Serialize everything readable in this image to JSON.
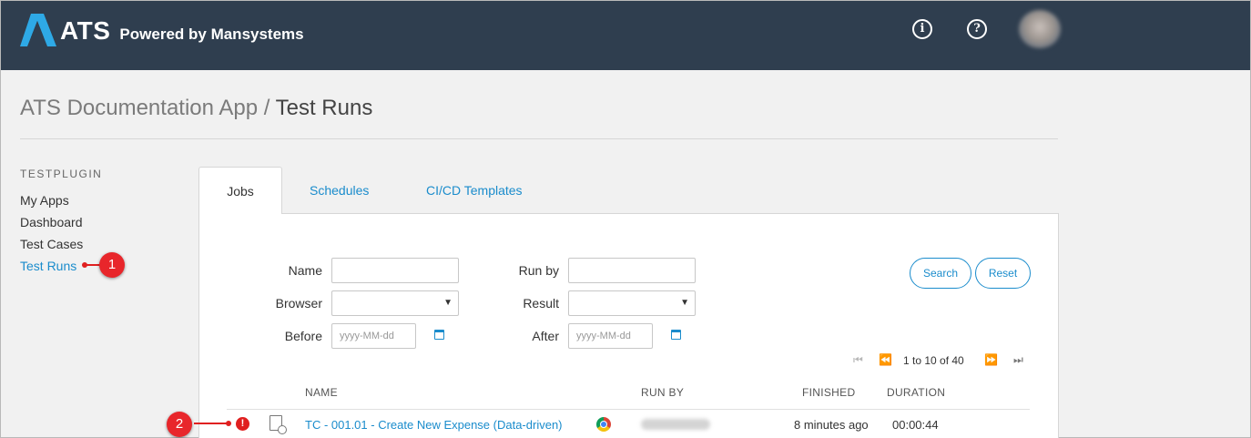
{
  "header": {
    "logo_text": "ATS",
    "logo_sub": "Powered by Mansystems",
    "info_icon": "info-icon",
    "help_icon": "help-icon",
    "colors": {
      "bar": "#2f3e4f",
      "accent": "#1a8ccc",
      "marker": "#e02020"
    }
  },
  "breadcrumb": {
    "app": "ATS Documentation App",
    "separator": " / ",
    "current": "Test Runs"
  },
  "sidebar": {
    "title": "TESTPLUGIN",
    "items": [
      {
        "label": "My Apps"
      },
      {
        "label": "Dashboard"
      },
      {
        "label": "Test Cases"
      },
      {
        "label": "Test Runs",
        "active": true
      }
    ]
  },
  "markers": {
    "m1": "1",
    "m2": "2"
  },
  "tabs": [
    {
      "label": "Jobs",
      "active": true
    },
    {
      "label": "Schedules"
    },
    {
      "label": "CI/CD Templates"
    }
  ],
  "filters": {
    "name_label": "Name",
    "browser_label": "Browser",
    "before_label": "Before",
    "runby_label": "Run by",
    "result_label": "Result",
    "after_label": "After",
    "before_placeholder": "yyyy-MM-dd",
    "after_placeholder": "yyyy-MM-dd",
    "search_label": "Search",
    "reset_label": "Reset"
  },
  "pager": {
    "text": "1 to 10 of 40"
  },
  "table": {
    "headers": {
      "name": "NAME",
      "run_by": "RUN BY",
      "finished": "FINISHED",
      "duration": "DURATION"
    },
    "rows": [
      {
        "status": "error",
        "name": "TC - 001.01 - Create New Expense (Data-driven)",
        "browser": "chrome-icon",
        "finished": "8 minutes ago",
        "duration": "00:00:44"
      }
    ]
  }
}
